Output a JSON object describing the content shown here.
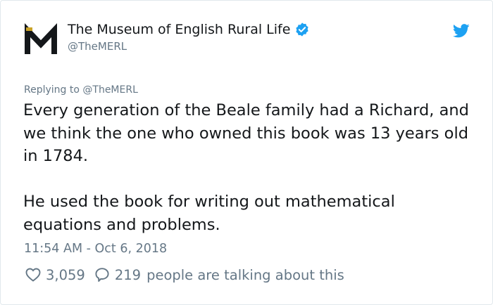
{
  "author": {
    "name": "The Museum of English Rural Life",
    "handle": "@TheMERL",
    "avatar_letter": "M"
  },
  "reply": {
    "prefix": "Replying to",
    "to": "@TheMERL"
  },
  "tweet": {
    "paragraph_1": "Every generation of the Beale family had a Richard, and we think the one who owned this book was 13 years old in 1784.",
    "paragraph_2": "He used the book for writing out mathematical equations and problems.",
    "timestamp": "11:54 AM - Oct 6, 2018"
  },
  "engagement": {
    "likes": "3,059",
    "talking_count": "219",
    "talking_label": "people are talking about this"
  },
  "icons": {
    "avatar": "museum-logo-icon",
    "verified": "verified-badge-icon",
    "brand": "twitter-bird-icon",
    "like": "heart-icon",
    "comment": "comment-bubble-icon"
  },
  "colors": {
    "text": "#14171a",
    "secondary": "#657786",
    "brand_blue": "#1da1f2",
    "logo_gold": "#c9a227",
    "border": "#e1e8ed"
  }
}
